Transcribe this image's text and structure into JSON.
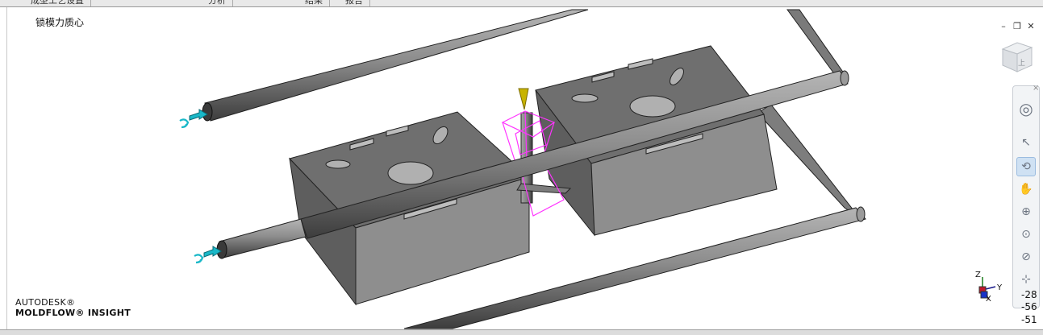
{
  "top_tabs": [
    "成型工艺设置",
    "分析",
    "结果",
    "报告"
  ],
  "viewport": {
    "title": "锁模力质心"
  },
  "branding": {
    "line1": "AUTODESK®",
    "line2": "MOLDFLOW® INSIGHT"
  },
  "window_controls": {
    "minimize": "–",
    "restore": "❐",
    "close": "✕"
  },
  "viewcube": {
    "face_label": "上"
  },
  "navbar": {
    "close": "×",
    "tools": [
      {
        "name": "steering-wheel",
        "glyph": "◎"
      },
      {
        "name": "select",
        "glyph": "↖"
      },
      {
        "name": "orbit",
        "glyph": "⟲",
        "active": true
      },
      {
        "name": "pan",
        "glyph": "✋"
      },
      {
        "name": "zoom",
        "glyph": "⊕"
      },
      {
        "name": "zoom-window",
        "glyph": "⊙"
      },
      {
        "name": "zoom-extents",
        "glyph": "⊘"
      },
      {
        "name": "center",
        "glyph": "⊹"
      }
    ]
  },
  "triad": {
    "z": "Z",
    "y": "Y",
    "x": "X"
  },
  "coordinates": [
    "-28",
    "-56",
    "-51"
  ],
  "colors": {
    "part": "#6e6e6e",
    "part_face": "#8a8a8a",
    "runner": "#8c8c8c",
    "cooling_inlet": "#19b8c8",
    "clamp_center": "#ff33ff",
    "gate_cone": "#c8b400"
  }
}
